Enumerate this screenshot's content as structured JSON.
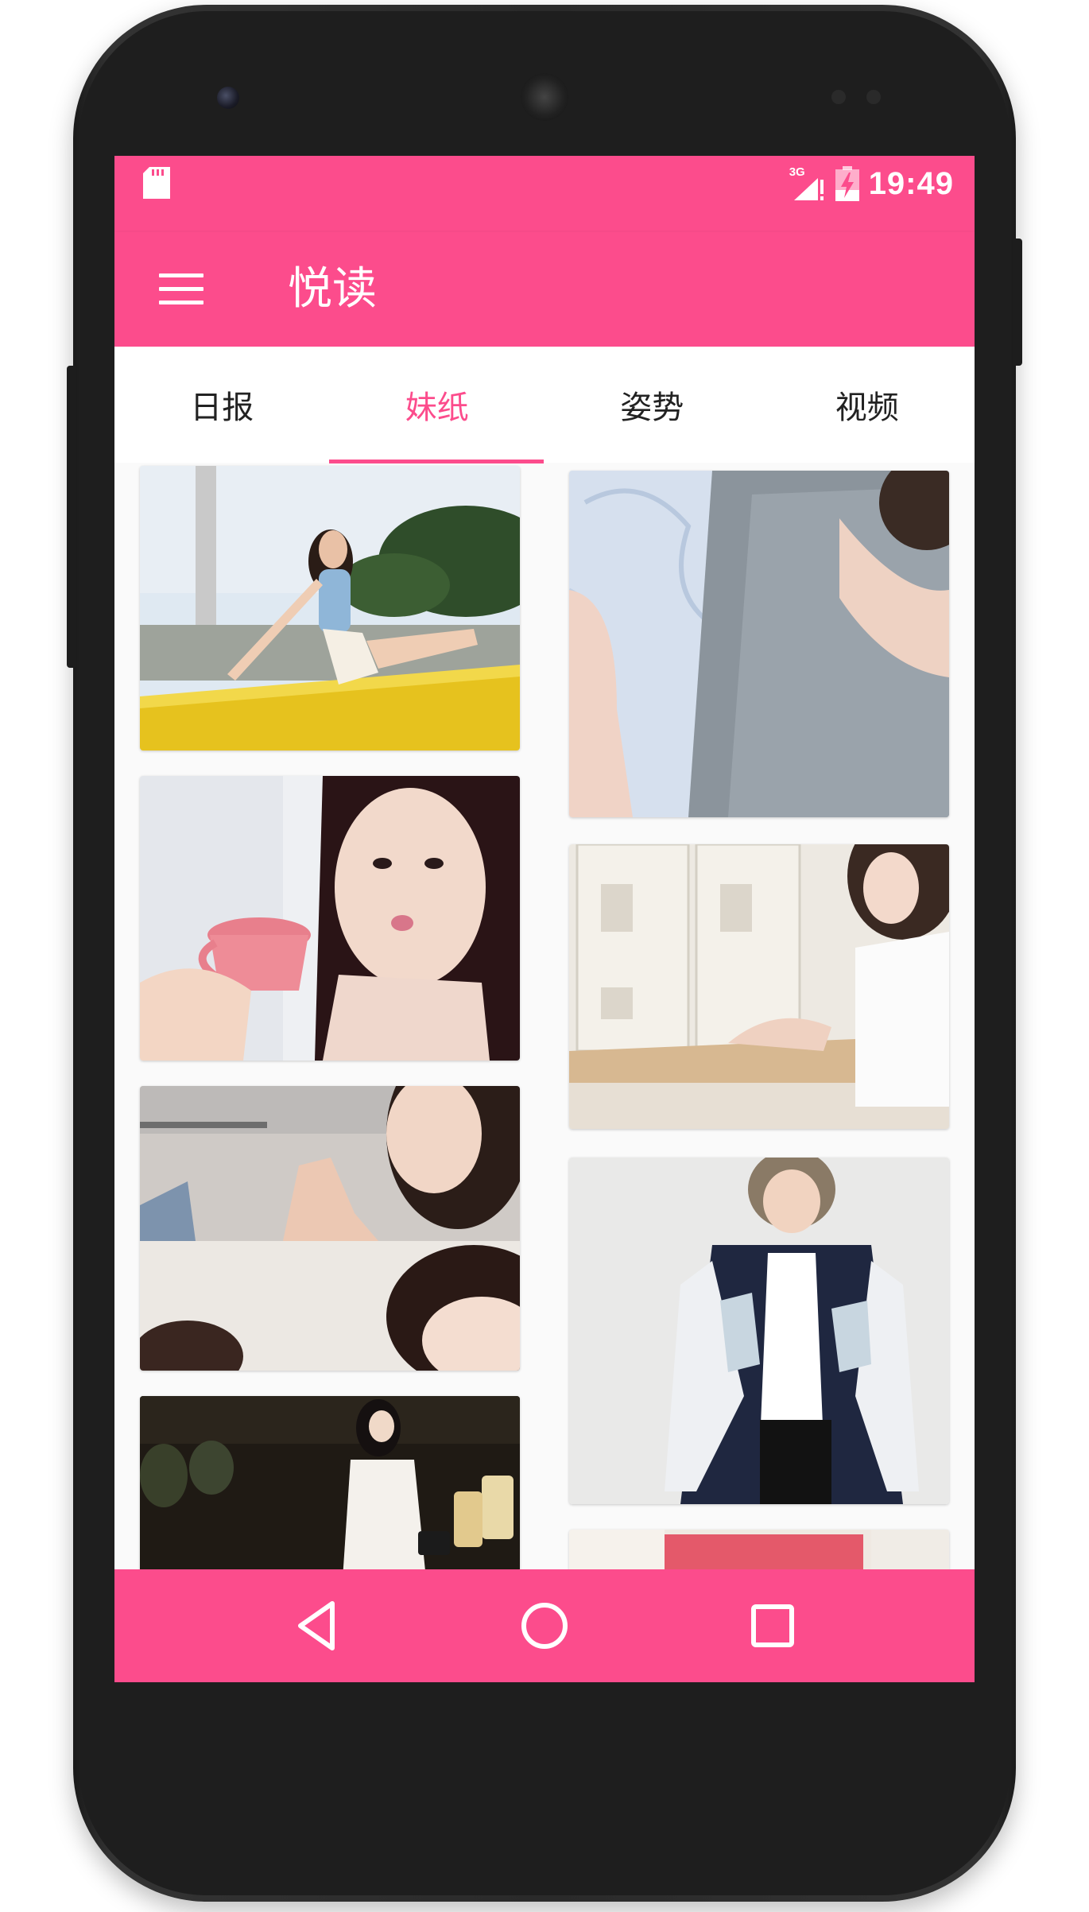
{
  "status_bar": {
    "time": "19:49",
    "network": "3G",
    "icons": [
      "sd-card-icon",
      "signal-icon",
      "battery-icon"
    ]
  },
  "app_bar": {
    "title": "悦读",
    "menu_icon": "menu-icon"
  },
  "tabs": [
    {
      "label": "日报",
      "active": false
    },
    {
      "label": "妹纸",
      "active": true
    },
    {
      "label": "姿势",
      "active": false
    },
    {
      "label": "视频",
      "active": false
    }
  ],
  "gallery": {
    "left_column": [
      "photo-sailboat",
      "photo-pink-cup",
      "photo-collage",
      "photo-night-street"
    ],
    "right_column": [
      "photo-grey-shirt",
      "photo-lockers",
      "photo-souvenir-jacket",
      "photo-partial"
    ]
  },
  "nav_bar": {
    "buttons": [
      "back-icon",
      "home-icon",
      "recents-icon"
    ]
  },
  "colors": {
    "primary": "#fc4c8c",
    "background": "#fafafa",
    "tab_text": "#222222"
  }
}
